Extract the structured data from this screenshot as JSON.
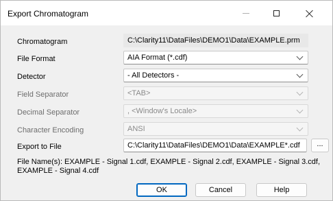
{
  "window": {
    "title": "Export Chromatogram"
  },
  "form": {
    "chromatogram": {
      "label": "Chromatogram",
      "value": "C:\\Clarity11\\DataFiles\\DEMO1\\Data\\EXAMPLE.prm"
    },
    "file_format": {
      "label": "File Format",
      "value": "AIA Format (*.cdf)"
    },
    "detector": {
      "label": "Detector",
      "value": "- All Detectors -"
    },
    "field_separator": {
      "label": "Field Separator",
      "value": "<TAB>"
    },
    "decimal_separator": {
      "label": "Decimal Separator",
      "value": ", <Window's Locale>"
    },
    "character_encoding": {
      "label": "Character Encoding",
      "value": "ANSI"
    },
    "export_to_file": {
      "label": "Export to File",
      "value": "C:\\Clarity11\\DataFiles\\DEMO1\\Data\\EXAMPLE*.cdf",
      "browse_label": "..."
    }
  },
  "file_names": "File Name(s): EXAMPLE - Signal 1.cdf, EXAMPLE - Signal 2.cdf, EXAMPLE - Signal 3.cdf, EXAMPLE - Signal 4.cdf",
  "buttons": {
    "ok": "OK",
    "cancel": "Cancel",
    "help": "Help"
  }
}
